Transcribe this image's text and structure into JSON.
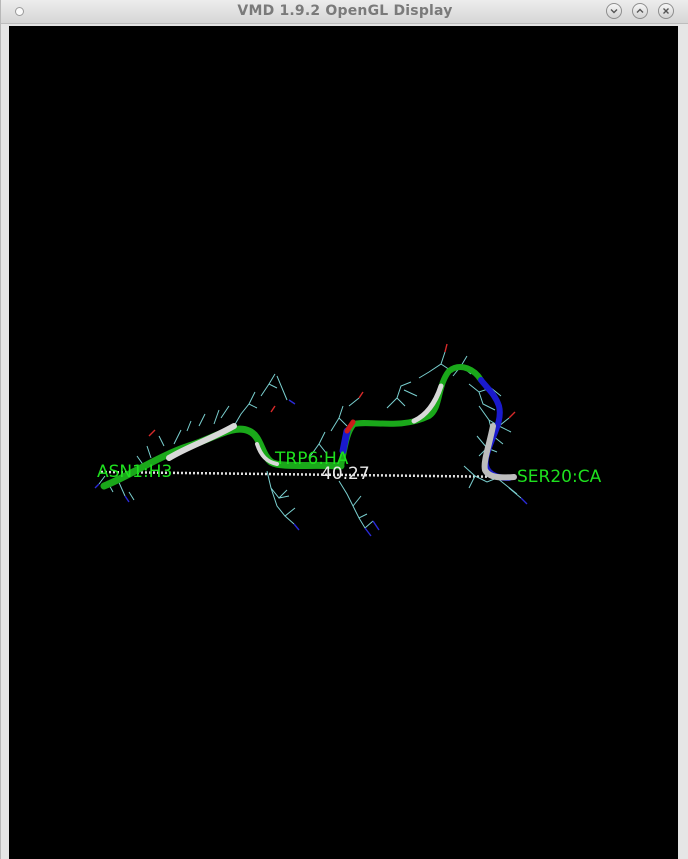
{
  "window": {
    "title": "VMD 1.9.2 OpenGL Display",
    "controls": [
      "minimize",
      "maximize",
      "close"
    ]
  },
  "display": {
    "background": "#000000",
    "atom_labels": [
      "ASN1:H3",
      "TRP6:HA",
      "SER20:CA"
    ],
    "distance_label": "40.27",
    "label_color": "#1ee01e",
    "distance_color": "#e8e8e8",
    "ribbon_colors": [
      "#1aa81a",
      "#d8d8d8",
      "#1a1acc",
      "#cc1a1a"
    ],
    "bond_color": "#7ad0d0"
  }
}
